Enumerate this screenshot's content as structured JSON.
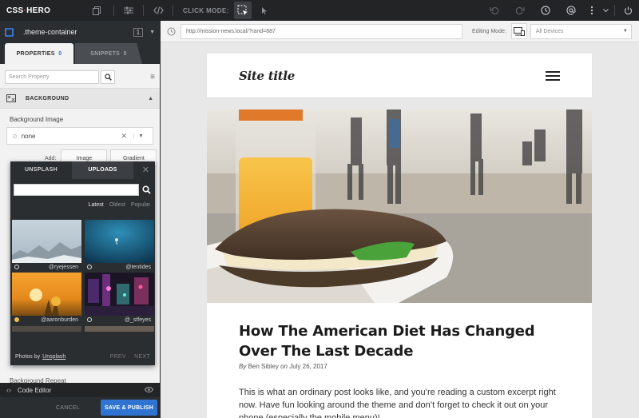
{
  "app": {
    "brand_left": "CSS",
    "brand_sep": "·",
    "brand_right": "HERO",
    "click_mode_label": "CLICK MODE:"
  },
  "panel": {
    "selector": ".theme-container",
    "selector_count": "1",
    "tabs": [
      {
        "label": "PROPERTIES",
        "count": "0"
      },
      {
        "label": "SNIPPETS",
        "count": "0"
      }
    ],
    "search_placeholder": "Search Property",
    "section": "BACKGROUND",
    "bg_image_label": "Background Image",
    "bg_image_value": "none",
    "add_label": "Add:",
    "add_buttons": [
      "Image",
      "Gradient"
    ],
    "bg_repeat_label": "Background Repeat"
  },
  "popup": {
    "tabs": [
      "UNSPLASH",
      "UPLOADS"
    ],
    "filters": [
      "Latest",
      "Oldest",
      "Popular"
    ],
    "photos": [
      {
        "credit": "@ryejessen"
      },
      {
        "credit": "@tentides"
      },
      {
        "credit": "@aaronburden"
      },
      {
        "credit": "@_stfeyes"
      }
    ],
    "footer_text": "Photos by",
    "footer_link": "Unsplash",
    "prev": "PREV",
    "next": "NEXT"
  },
  "editor": {
    "code_editor_label": "Code Editor",
    "cancel": "CANCEL",
    "save": "SAVE & PUBLISH"
  },
  "urlbar": {
    "url": "http://mission-news.local/?rand=887",
    "editing_mode_label": "Editing Mode:",
    "device_value": "All Devices"
  },
  "site": {
    "title": "Site title",
    "post_title": "How The American Diet Has Changed Over The Last Decade",
    "meta_by": "By",
    "meta_author": "Ben Sibley",
    "meta_on": "on",
    "meta_date": "July 26, 2017",
    "excerpt": "This is what an ordinary post looks like, and you’re reading a custom excerpt right now. Have fun looking around the theme and don’t forget to check it out on your phone (especially the mobile menu)!"
  },
  "colors": {
    "accent": "#2f74d0",
    "toolbar_bg": "#222426",
    "panel_bg": "#f2f2f2"
  }
}
